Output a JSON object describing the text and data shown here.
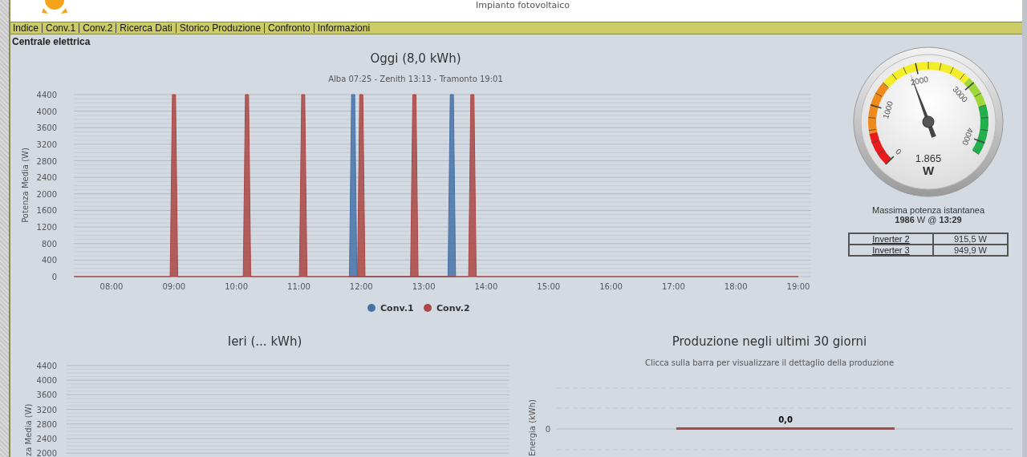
{
  "header": {
    "subtitle": "Impianto fotovoltaico"
  },
  "nav": [
    {
      "label": "Indice"
    },
    {
      "label": "Conv.1"
    },
    {
      "label": "Conv.2"
    },
    {
      "label": "Ricerca Dati"
    },
    {
      "label": "Storico Produzione"
    },
    {
      "label": "Confronto"
    },
    {
      "label": "Informazioni"
    }
  ],
  "section_title": "Centrale elettrica",
  "today_chart": {
    "subtitle": "Alba 07:25 - Zenith 13:13 - Tramonto 19:01",
    "chart_data": {
      "type": "area",
      "title": "Oggi (8,0 kWh)",
      "ylabel": "Potenza Media (W)",
      "x": [
        7.4,
        8.94,
        8.975,
        9.025,
        9.06,
        10.11,
        10.145,
        10.195,
        10.23,
        11.01,
        11.045,
        11.095,
        11.13,
        11.81,
        11.845,
        11.895,
        11.93,
        11.94,
        11.975,
        12.025,
        12.06,
        12.79,
        12.825,
        12.875,
        12.91,
        13.39,
        13.425,
        13.475,
        13.51,
        13.72,
        13.755,
        13.805,
        13.84,
        19.0
      ],
      "series": [
        {
          "name": "Conv.1",
          "color": "#4572a7",
          "values": [
            null,
            null,
            null,
            null,
            null,
            null,
            null,
            null,
            null,
            null,
            null,
            null,
            null,
            0,
            4400,
            4400,
            0,
            0,
            0,
            0,
            0,
            0,
            0,
            0,
            0,
            0,
            4400,
            4400,
            0,
            null,
            null,
            null,
            null,
            null
          ]
        },
        {
          "name": "Conv.2",
          "color": "#aa4643",
          "values": [
            0,
            0,
            4400,
            4400,
            0,
            0,
            4400,
            4400,
            0,
            0,
            4400,
            4400,
            0,
            0,
            0,
            0,
            0,
            0,
            4400,
            4400,
            0,
            0,
            4400,
            4400,
            0,
            0,
            0,
            0,
            0,
            0,
            4400,
            4400,
            0,
            0
          ]
        }
      ],
      "xlim": [
        7.4,
        19.2
      ],
      "ylim": [
        0,
        4400
      ],
      "grid": true,
      "legend": "bottom",
      "xticks": [
        {
          "value": 8,
          "label": "08:00"
        },
        {
          "value": 9,
          "label": "09:00"
        },
        {
          "value": 10,
          "label": "10:00"
        },
        {
          "value": 11,
          "label": "11:00"
        },
        {
          "value": 12,
          "label": "12:00"
        },
        {
          "value": 13,
          "label": "13:00"
        },
        {
          "value": 14,
          "label": "14:00"
        },
        {
          "value": 15,
          "label": "15:00"
        },
        {
          "value": 16,
          "label": "16:00"
        },
        {
          "value": 17,
          "label": "17:00"
        },
        {
          "value": 18,
          "label": "18:00"
        },
        {
          "value": 19,
          "label": "19:00"
        }
      ],
      "yticks": [
        0,
        400,
        800,
        1200,
        1600,
        2000,
        2400,
        2800,
        3200,
        3600,
        4000,
        4400
      ]
    }
  },
  "gauge": {
    "level": 0.424,
    "reading": "1.865",
    "unit": "W",
    "scale_labels": [
      "0",
      "1000",
      "2000",
      "3000",
      "4000"
    ]
  },
  "max_power": {
    "label": "Massima potenza istantanea",
    "value": "**1986** W @ **13:29**"
  },
  "inverters": [
    {
      "name": "Inverter 2",
      "power": "915,5 W"
    },
    {
      "name": "Inverter 3",
      "power": "949,9 W"
    }
  ],
  "yesterday_chart": {
    "chart_data": {
      "type": "area",
      "grid": true,
      "title": "Ieri (... kWh)",
      "ylabel": "za Media (W)",
      "categories": [
        null
      ],
      "values": [
        null
      ],
      "ylim": [
        2000,
        4400
      ],
      "yticks": [
        4400,
        4000,
        3600,
        3200,
        2800,
        2400,
        2000
      ]
    }
  },
  "month_chart": {
    "title": "Produzione negli ultimi 30 giorni",
    "subtitle": "Clicca sulla barra per visualizzare il dettaglio della produzione",
    "ylabel": "Energia (kWh)",
    "tick_label": "0",
    "bar_label": "0,0"
  }
}
